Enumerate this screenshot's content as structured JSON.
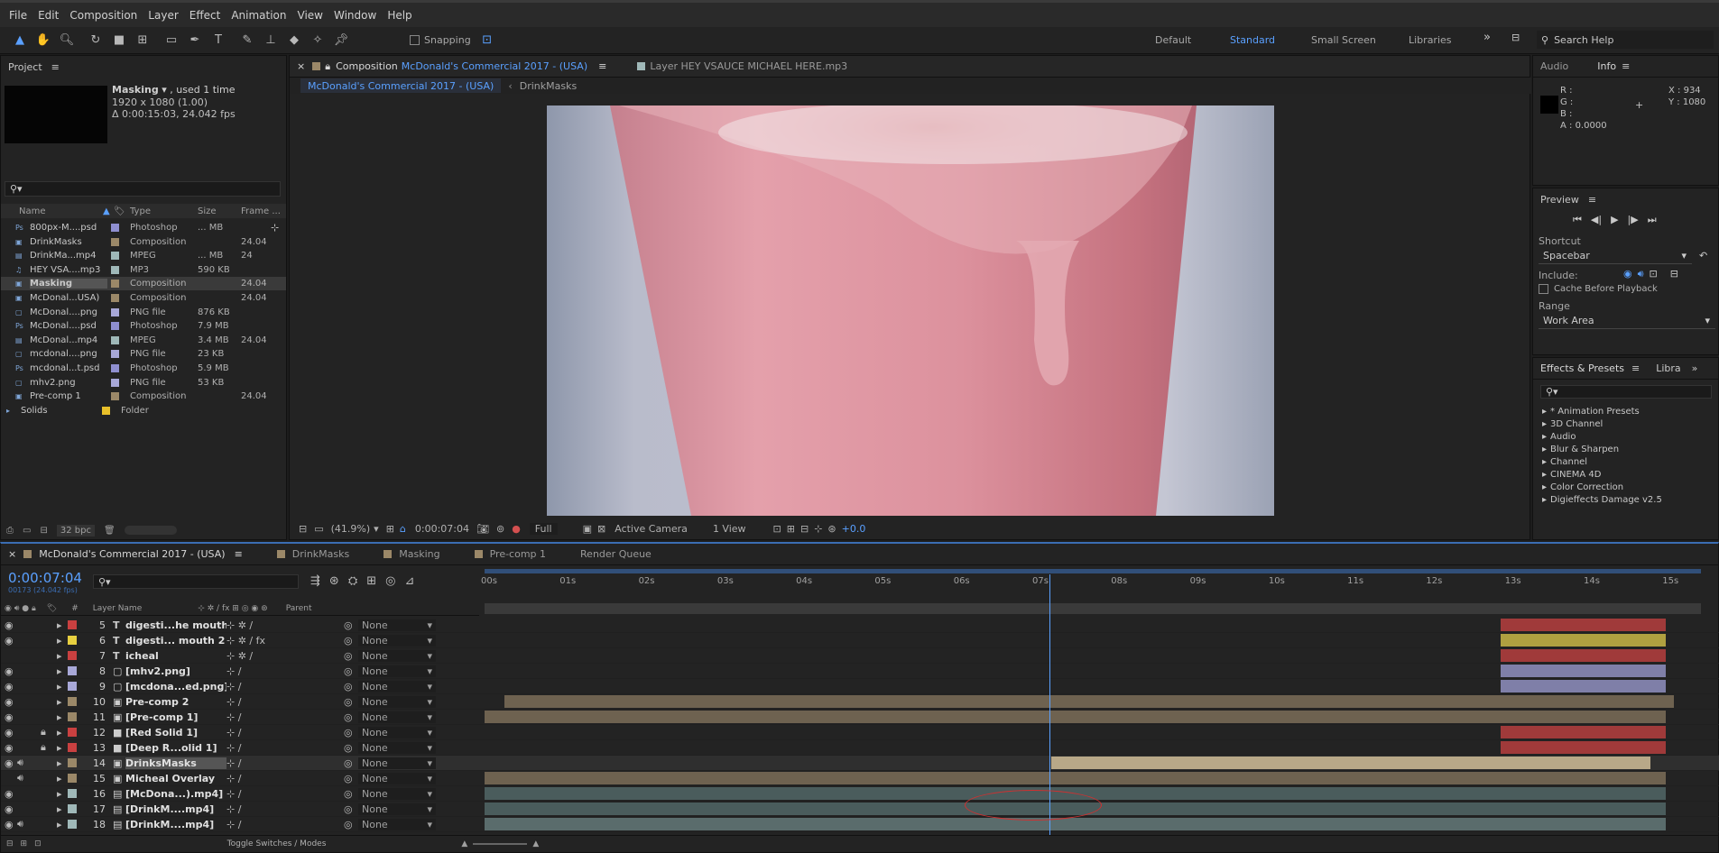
{
  "menu": [
    "File",
    "Edit",
    "Composition",
    "Layer",
    "Effect",
    "Animation",
    "View",
    "Window",
    "Help"
  ],
  "toolbar": {
    "snapping_label": "Snapping",
    "workspaces": [
      "Default",
      "Standard",
      "Small Screen",
      "Libraries"
    ],
    "active_workspace": "Standard",
    "search_placeholder": "Search Help"
  },
  "project": {
    "title": "Project",
    "selected_name": "Masking",
    "used": ", used 1 time",
    "dims": "1920 x 1080 (1.00)",
    "duration": "Δ 0:00:15:03, 24.042 fps",
    "columns": [
      "Name",
      "Type",
      "Size",
      "Frame ..."
    ],
    "items": [
      {
        "name": "800px-M....psd",
        "type": "Photoshop",
        "size": "... MB",
        "fps": "",
        "color": "#8f8fd0",
        "icon": "psd-icon"
      },
      {
        "name": "DrinkMasks",
        "type": "Composition",
        "size": "",
        "fps": "24.04",
        "color": "#9b8868",
        "icon": "comp-icon"
      },
      {
        "name": "DrinkMa...mp4",
        "type": "MPEG",
        "size": "... MB",
        "fps": "24",
        "color": "#9fb8b8",
        "icon": "video-icon"
      },
      {
        "name": "HEY VSA....mp3",
        "type": "MP3",
        "size": "590 KB",
        "fps": "",
        "color": "#9fb8b8",
        "icon": "audio-icon"
      },
      {
        "name": "Masking",
        "type": "Composition",
        "size": "",
        "fps": "24.04",
        "color": "#9b8868",
        "icon": "comp-icon",
        "selected": true
      },
      {
        "name": "McDonal...USA)",
        "type": "Composition",
        "size": "",
        "fps": "24.04",
        "color": "#9b8868",
        "icon": "comp-icon"
      },
      {
        "name": "McDonal....png",
        "type": "PNG file",
        "size": "876 KB",
        "fps": "",
        "color": "#a8a8d8",
        "icon": "image-icon"
      },
      {
        "name": "McDonal....psd",
        "type": "Photoshop",
        "size": "7.9 MB",
        "fps": "",
        "color": "#8f8fd0",
        "icon": "psd-icon"
      },
      {
        "name": "McDonal...mp4",
        "type": "MPEG",
        "size": "3.4 MB",
        "fps": "24.04",
        "color": "#9fb8b8",
        "icon": "video-icon"
      },
      {
        "name": "mcdonal....png",
        "type": "PNG file",
        "size": "23 KB",
        "fps": "",
        "color": "#a8a8d8",
        "icon": "image-icon"
      },
      {
        "name": "mcdonal...t.psd",
        "type": "Photoshop",
        "size": "5.9 MB",
        "fps": "",
        "color": "#8f8fd0",
        "icon": "psd-icon"
      },
      {
        "name": "mhv2.png",
        "type": "PNG file",
        "size": "53 KB",
        "fps": "",
        "color": "#a8a8d8",
        "icon": "image-icon"
      },
      {
        "name": "Pre-comp 1",
        "type": "Composition",
        "size": "",
        "fps": "24.04",
        "color": "#9b8868",
        "icon": "comp-icon"
      },
      {
        "name": "Solids",
        "type": "Folder",
        "size": "",
        "fps": "",
        "color": "#e8c02a",
        "icon": "folder-icon"
      }
    ],
    "bpc": "32 bpc"
  },
  "viewer": {
    "comp_tab_prefix": "Composition",
    "comp_name": "McDonald's Commercial 2017 - (USA)",
    "layer_tab": "Layer  HEY VSAUCE MICHAEL HERE.mp3",
    "breadcrumb_1": "McDonald's Commercial 2017 - (USA)",
    "breadcrumb_2": "DrinkMasks",
    "zoom": "(41.9%)",
    "timecode": "0:00:07:04",
    "resolution": "Full",
    "camera": "Active Camera",
    "views": "1 View",
    "exposure": "+0.0"
  },
  "info": {
    "tab_audio": "Audio",
    "tab_info": "Info",
    "r": "R :",
    "g": "G :",
    "b": "B :",
    "a": "A :  0.0000",
    "x": "X : 934",
    "y": "Y : 1080"
  },
  "preview": {
    "title": "Preview",
    "shortcut_label": "Shortcut",
    "shortcut_value": "Spacebar",
    "include_label": "Include:",
    "cache_label": "Cache Before Playback",
    "range_label": "Range",
    "range_value": "Work Area"
  },
  "effects": {
    "tab": "Effects & Presets",
    "tab2": "Libra",
    "items": [
      "* Animation Presets",
      "3D Channel",
      "Audio",
      "Blur & Sharpen",
      "Channel",
      "CINEMA 4D",
      "Color Correction",
      "Digieffects Damage v2.5"
    ]
  },
  "timeline": {
    "tabs": [
      "McDonald's Commercial 2017 - (USA)",
      "DrinkMasks",
      "Masking",
      "Pre-comp 1",
      "Render Queue"
    ],
    "timecode": "0:00:07:04",
    "frame_info": "00173 (24.042 fps)",
    "col_num": "#",
    "col_layer": "Layer Name",
    "col_parent": "Parent",
    "ruler": [
      "00s",
      "01s",
      "02s",
      "03s",
      "04s",
      "05s",
      "06s",
      "07s",
      "08s",
      "09s",
      "10s",
      "11s",
      "12s",
      "13s",
      "14s",
      "15s"
    ],
    "current_time_sec": 7.17,
    "duration_sec": 15.1,
    "layers": [
      {
        "num": "5",
        "name": "digesti...he mouth",
        "type": "T",
        "label": "#c94040",
        "start": 12.9,
        "end": 15.0,
        "bar": "#a03a3a",
        "eye": true,
        "fx": false
      },
      {
        "num": "6",
        "name": "digesti... mouth 2",
        "type": "T",
        "label": "#e8d040",
        "start": 12.9,
        "end": 15.0,
        "bar": "#b0a040",
        "eye": true,
        "fx": true
      },
      {
        "num": "7",
        "name": "icheal",
        "type": "T",
        "label": "#c94040",
        "start": 12.9,
        "end": 15.0,
        "bar": "#a03a3a",
        "eye": false,
        "fx": false
      },
      {
        "num": "8",
        "name": "[mhv2.png]",
        "type": "img",
        "label": "#a8a8d8",
        "start": 12.9,
        "end": 15.0,
        "bar": "#7f7fa8",
        "eye": true,
        "fx": false
      },
      {
        "num": "9",
        "name": "[mcdona...ed.png]",
        "type": "img",
        "label": "#a8a8d8",
        "start": 12.9,
        "end": 15.0,
        "bar": "#7f7fa8",
        "eye": true,
        "fx": false
      },
      {
        "num": "10",
        "name": "Pre-comp 2",
        "type": "comp",
        "label": "#9b8868",
        "start": 0.25,
        "end": 15.1,
        "bar": "#6e6250",
        "eye": true,
        "fx": false
      },
      {
        "num": "11",
        "name": "[Pre-comp 1]",
        "type": "comp",
        "label": "#9b8868",
        "start": 0.0,
        "end": 15.0,
        "bar": "#6e6250",
        "eye": true,
        "fx": false
      },
      {
        "num": "12",
        "name": "[Red Solid 1]",
        "type": "solid",
        "label": "#c94040",
        "start": 12.9,
        "end": 15.0,
        "bar": "#a03a3a",
        "eye": true,
        "fx": false,
        "lock": true
      },
      {
        "num": "13",
        "name": "[Deep R...olid 1]",
        "type": "solid",
        "label": "#c94040",
        "start": 12.9,
        "end": 15.0,
        "bar": "#a03a3a",
        "eye": true,
        "fx": false,
        "lock": true
      },
      {
        "num": "14",
        "name": "DrinksMasks",
        "type": "comp",
        "label": "#9b8868",
        "start": 7.2,
        "end": 14.8,
        "bar": "#b8a888",
        "eye": true,
        "fx": false,
        "selected": true
      },
      {
        "num": "15",
        "name": "Micheal Overlay",
        "type": "comp",
        "label": "#9b8868",
        "start": 0.0,
        "end": 15.0,
        "bar": "#6e6250",
        "eye": false,
        "fx": false
      },
      {
        "num": "16",
        "name": "[McDona...).mp4]",
        "type": "video",
        "label": "#9fb8b8",
        "start": 0.0,
        "end": 15.0,
        "bar": "#4a5c5c",
        "eye": true,
        "fx": false
      },
      {
        "num": "17",
        "name": "[DrinkM....mp4]",
        "type": "video",
        "label": "#9fb8b8",
        "start": 0.0,
        "end": 15.0,
        "bar": "#4a5c5c",
        "eye": true,
        "fx": false
      },
      {
        "num": "18",
        "name": "[DrinkM....mp4]",
        "type": "video",
        "label": "#9fb8b8",
        "start": 0.0,
        "end": 15.0,
        "bar": "#5a6c6c",
        "eye": true,
        "fx": false
      }
    ],
    "parent_value": "None",
    "toggle_label": "Toggle Switches / Modes"
  }
}
